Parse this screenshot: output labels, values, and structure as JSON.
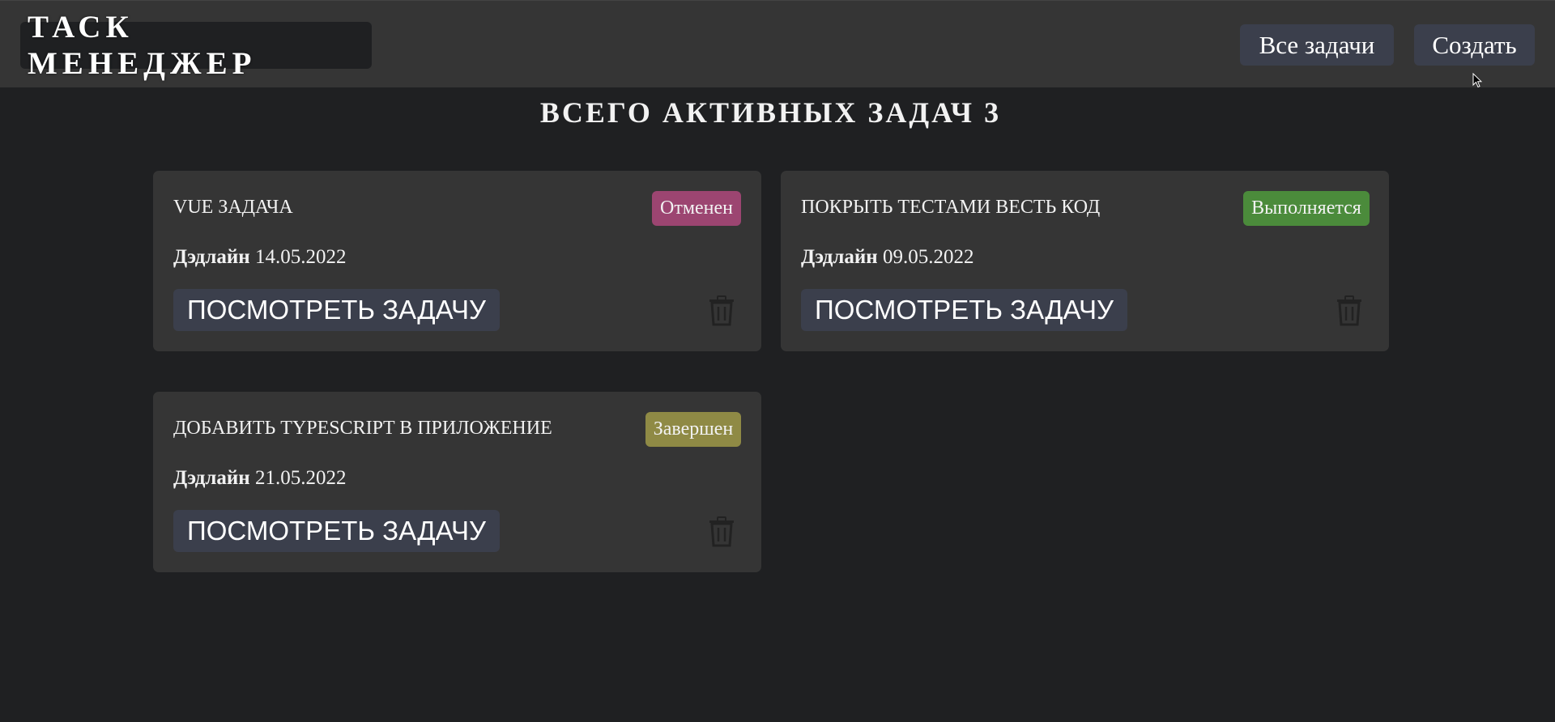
{
  "header": {
    "logo": "ТАСК МЕНЕДЖЕР",
    "nav": [
      {
        "label": "Все задачи"
      },
      {
        "label": "Создать"
      }
    ]
  },
  "main": {
    "title": "ВСЕГО АКТИВНЫХ ЗАДАЧ 3",
    "deadline_label": "Дэдлайн",
    "view_button_label": "ПОСМОТРЕТЬ ЗАДАЧУ",
    "tasks": [
      {
        "title": "VUE ЗАДАЧА",
        "status": "Отменен",
        "status_color": "#9c4571",
        "deadline": "14.05.2022"
      },
      {
        "title": "ПОКРЫТЬ ТЕСТАМИ ВЕСТЬ КОД",
        "status": "Выполняется",
        "status_color": "#4b8b3b",
        "deadline": "09.05.2022"
      },
      {
        "title": "ДОБАВИТЬ TYPESCRIPT В ПРИЛОЖЕНИЕ",
        "status": "Завершен",
        "status_color": "#8f8a45",
        "deadline": "21.05.2022"
      }
    ]
  },
  "icons": {
    "delete": "trash-icon",
    "cursor": "mouse-cursor-icon"
  },
  "colors": {
    "background": "#1f2022",
    "header": "#353535",
    "card": "#353535",
    "button": "#3b3f4c"
  }
}
